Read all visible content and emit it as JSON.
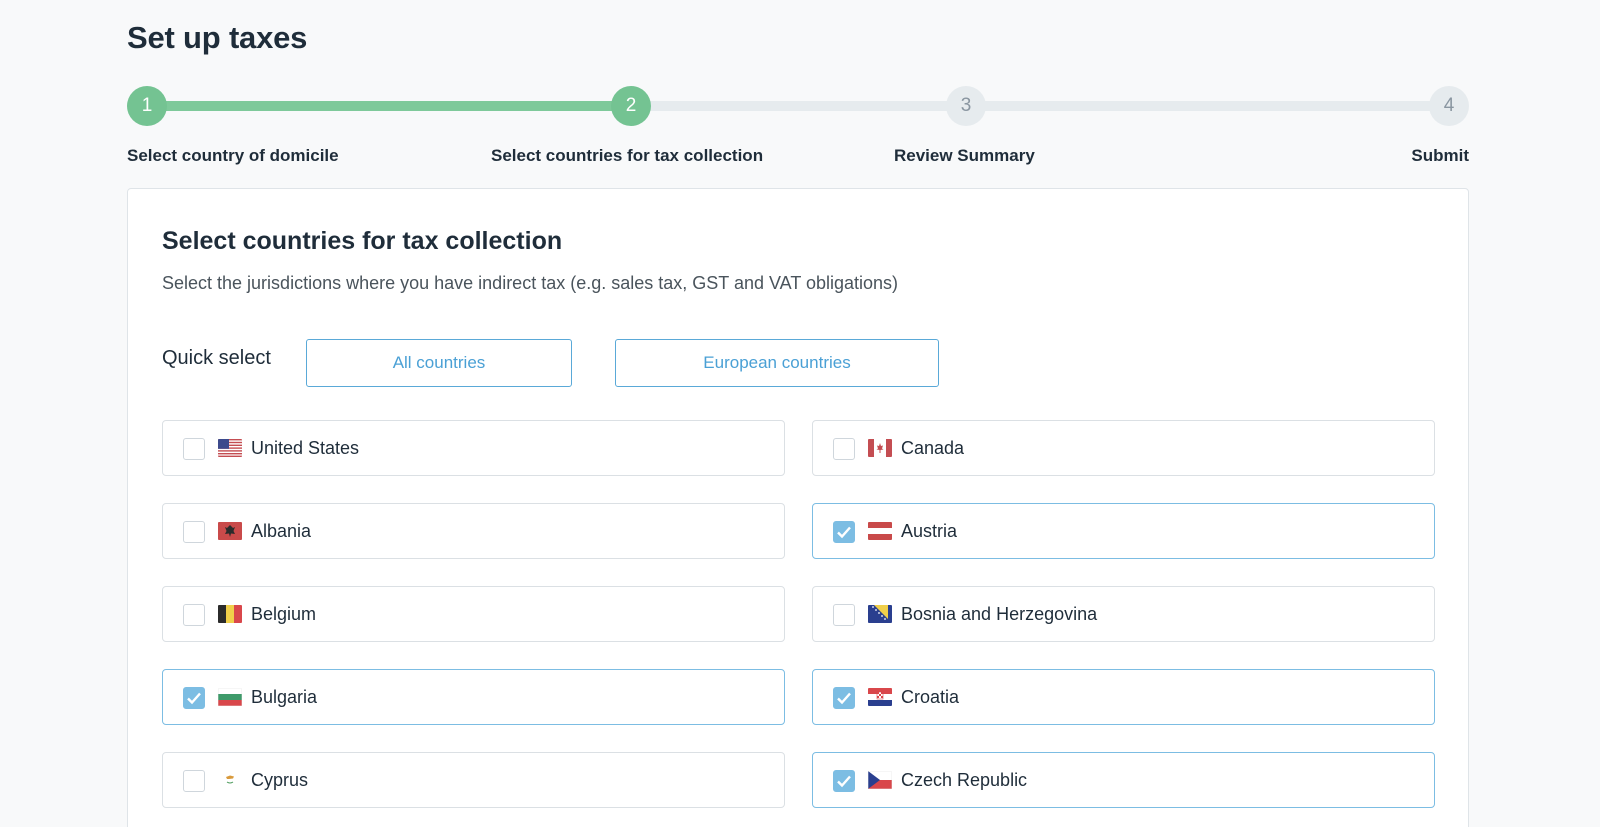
{
  "page": {
    "title": "Set up taxes"
  },
  "stepper": {
    "steps": [
      {
        "number": "1",
        "label": "Select country of domicile",
        "state": "complete"
      },
      {
        "number": "2",
        "label": "Select countries for tax collection",
        "state": "current"
      },
      {
        "number": "3",
        "label": "Review Summary",
        "state": "pending"
      },
      {
        "number": "4",
        "label": "Submit",
        "state": "pending"
      }
    ]
  },
  "card": {
    "title": "Select countries for tax collection",
    "subtitle": "Select the jurisdictions where you have indirect tax (e.g. sales tax, GST and VAT obligations)",
    "quick_select": {
      "label": "Quick select",
      "all_label": "All countries",
      "eu_label": "European countries"
    },
    "countries": [
      {
        "name": "United States",
        "flag": "us-flag-icon",
        "checked": false
      },
      {
        "name": "Canada",
        "flag": "ca-flag-icon",
        "checked": false
      },
      {
        "name": "Albania",
        "flag": "al-flag-icon",
        "checked": false
      },
      {
        "name": "Austria",
        "flag": "at-flag-icon",
        "checked": true
      },
      {
        "name": "Belgium",
        "flag": "be-flag-icon",
        "checked": false
      },
      {
        "name": "Bosnia and Herzegovina",
        "flag": "ba-flag-icon",
        "checked": false
      },
      {
        "name": "Bulgaria",
        "flag": "bg-flag-icon",
        "checked": true
      },
      {
        "name": "Croatia",
        "flag": "hr-flag-icon",
        "checked": true
      },
      {
        "name": "Cyprus",
        "flag": "cy-flag-icon",
        "checked": false
      },
      {
        "name": "Czech Republic",
        "flag": "cz-flag-icon",
        "checked": true
      }
    ]
  },
  "colors": {
    "complete": "#74c392",
    "pending": "#e6ebee",
    "accent": "#4aa0d5",
    "checked": "#7cbde3"
  }
}
